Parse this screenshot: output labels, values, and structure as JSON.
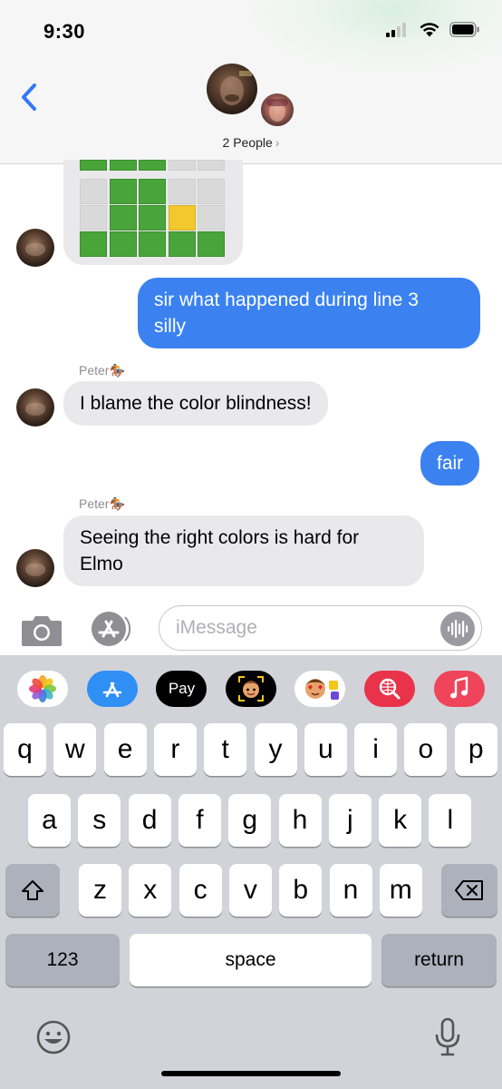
{
  "status_bar": {
    "time": "9:30",
    "icons": [
      "cellular-signal-icon",
      "wifi-icon",
      "battery-icon"
    ]
  },
  "header": {
    "back_icon": "chevron-left-icon",
    "group_label": "2 People",
    "group_chevron": "›"
  },
  "messages": [
    {
      "type": "image",
      "direction": "incoming",
      "content": "wordle-grid"
    },
    {
      "type": "text",
      "direction": "outgoing",
      "lines": [
        "sir what happened during line 3",
        "silly"
      ]
    },
    {
      "type": "text",
      "direction": "incoming",
      "sender": "Peter🏇",
      "lines": [
        "I blame the color blindness!"
      ]
    },
    {
      "type": "text",
      "direction": "outgoing",
      "lines": [
        "fair"
      ]
    },
    {
      "type": "text",
      "direction": "incoming",
      "sender": "Peter🏇",
      "lines": [
        "Seeing the right colors is hard for",
        "Elmo"
      ]
    }
  ],
  "wordle_grid_visible_rows": [
    [
      "G",
      "G",
      "G",
      "E",
      "E"
    ],
    [
      "E",
      "G",
      "G",
      "E",
      "E"
    ],
    [
      "E",
      "G",
      "G",
      "Y",
      "E"
    ],
    [
      "G",
      "G",
      "G",
      "G",
      "G"
    ]
  ],
  "colors": {
    "outgoing_bubble": "#3b82f0",
    "incoming_bubble": "#e9e9eb",
    "wordle_green": "#49a53a",
    "wordle_yellow": "#f2c82e",
    "ios_blue": "#3478f6"
  },
  "composer": {
    "placeholder": "iMessage",
    "camera_icon": "camera-icon",
    "apps_icon": "app-store-icon",
    "audio_icon": "audio-waveform-icon"
  },
  "app_strip": {
    "apple_pay_label": "Pay",
    "apple_pay_glyph": "",
    "icons": [
      "photos-icon",
      "app-store-icon",
      "apple-pay-icon",
      "memoji-icon",
      "animoji-stickers-icon",
      "web-search-icon",
      "music-icon"
    ]
  },
  "keyboard": {
    "row1": [
      "q",
      "w",
      "e",
      "r",
      "t",
      "y",
      "u",
      "i",
      "o",
      "p"
    ],
    "row2": [
      "a",
      "s",
      "d",
      "f",
      "g",
      "h",
      "j",
      "k",
      "l"
    ],
    "row3": [
      "z",
      "x",
      "c",
      "v",
      "b",
      "n",
      "m"
    ],
    "numbers": "123",
    "space": "space",
    "return": "return",
    "shift_icon": "shift-icon",
    "delete_icon": "delete-icon",
    "emoji_icon": "emoji-icon",
    "dictation_icon": "microphone-icon"
  }
}
